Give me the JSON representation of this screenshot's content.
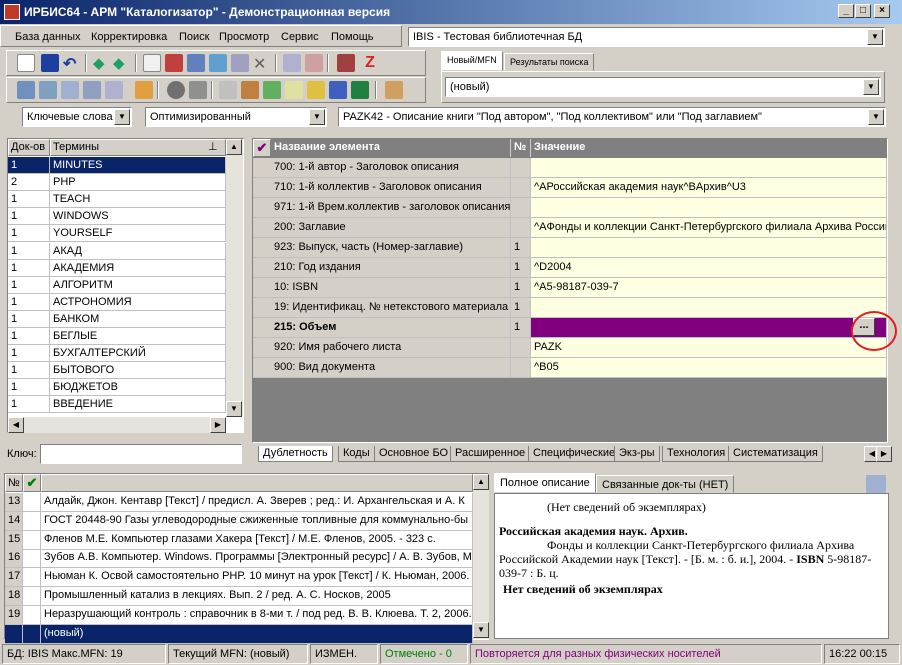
{
  "window": {
    "title": "ИРБИС64 - АРМ \"Каталогизатор\" - Демонстрационная версия",
    "minimize": "_",
    "maximize": "□",
    "close": "×"
  },
  "menu": [
    "База данных",
    "Корректировка",
    "Поиск",
    "Просмотр",
    "Сервис",
    "Помощь"
  ],
  "db_combo": "IBIS - Тестовая библиотечная БД",
  "record_tabs": [
    "Новый/MFN",
    "Результаты поиска"
  ],
  "record_combo": "(новый)",
  "search_mode": "Ключевые слова",
  "optimization": "Оптимизированный",
  "worksheet": "PAZK42 - Описание книги \"Под автором\", \"Под коллективом\" или \"Под заглавием\"",
  "terms": {
    "col_docs": "Док-ов",
    "col_terms": "Термины",
    "pin": "⊥",
    "rows": [
      {
        "count": "1",
        "term": "MINUTES"
      },
      {
        "count": "2",
        "term": "PHP"
      },
      {
        "count": "1",
        "term": "TEACH"
      },
      {
        "count": "1",
        "term": "WINDOWS"
      },
      {
        "count": "1",
        "term": "YOURSELF"
      },
      {
        "count": "1",
        "term": "АКАД"
      },
      {
        "count": "1",
        "term": "АКАДЕМИЯ"
      },
      {
        "count": "1",
        "term": "АЛГОРИТМ"
      },
      {
        "count": "1",
        "term": "АСТРОНОМИЯ"
      },
      {
        "count": "1",
        "term": "БАНКОМ"
      },
      {
        "count": "1",
        "term": "БЕГЛЫЕ"
      },
      {
        "count": "1",
        "term": "БУХГАЛТЕРСКИЙ"
      },
      {
        "count": "1",
        "term": "БЫТОВОГО"
      },
      {
        "count": "1",
        "term": "БЮДЖЕТОВ"
      },
      {
        "count": "1",
        "term": "ВВЕДЕНИЕ"
      }
    ],
    "key_label": "Ключ:"
  },
  "fields": {
    "check": "✔",
    "col_name": "Название элемента",
    "col_num": "№",
    "col_value": "Значение",
    "rows": [
      {
        "name": "700: 1-й  автор - Заголовок описания",
        "num": "",
        "value": ""
      },
      {
        "name": "710: 1-й коллектив - Заголовок описания",
        "num": "",
        "value": "^AРоссийская академия наук^BАрхив^U3"
      },
      {
        "name": "971: 1-й Врем.коллектив - заголовок описания",
        "num": "",
        "value": ""
      },
      {
        "name": "200: Заглавие",
        "num": "",
        "value": "^AФонды и коллекции Санкт-Петербургского филиала Архива Российс"
      },
      {
        "name": "923: Выпуск, часть (Номер-заглавие)",
        "num": "1",
        "value": ""
      },
      {
        "name": "210: Год издания",
        "num": "1",
        "value": "^D2004"
      },
      {
        "name": "10: ISBN",
        "num": "1",
        "value": "^A5-98187-039-7"
      },
      {
        "name": "19: Идентификац. № нетекстового материала",
        "num": "1",
        "value": ""
      },
      {
        "name": "215: Объем",
        "num": "1",
        "value": ""
      },
      {
        "name": "920: Имя рабочего листа",
        "num": "",
        "value": "PAZK"
      },
      {
        "name": "900: Вид документа",
        "num": "",
        "value": "^B05"
      }
    ],
    "ellipsis": "..."
  },
  "bottom_tabs": [
    "Дублетность",
    "Коды",
    "Основное БО",
    "Расширенное",
    "Специфические",
    "Экз-ры",
    "Технология",
    "Систематизация"
  ],
  "records": {
    "col_num": "№",
    "check": "✔",
    "rows": [
      {
        "n": "13",
        "text": "Алдайк, Джон. Кентавр [Текст] / предисл. А. Зверев ; ред.: И. Архангельская и А. К"
      },
      {
        "n": "14",
        "text": "ГОСТ 20448-90 Газы углеводородные сжиженные топливные для коммунально-бы"
      },
      {
        "n": "15",
        "text": "Фленов М.Е. Компьютер глазами Хакера [Текст] / М.Е. Фленов, 2005. - 323 с."
      },
      {
        "n": "16",
        "text": "Зубов А.В. Компьютер. Windows. Программы [Электронный ресурс] / А. В. Зубов, М"
      },
      {
        "n": "17",
        "text": "Ньюман К. Освой самостоятельно PHP. 10 минут на урок [Текст] / К. Ньюман, 2006."
      },
      {
        "n": "18",
        "text": "Промышленный катализ в лекциях. Вып. 2 / ред. А. С. Носков, 2005"
      },
      {
        "n": "19",
        "text": "Неразрушающий контроль : справочник в 8-ми т. / под ред. В. В. Клюева. Т. 2, 2006."
      },
      {
        "n": "",
        "text": "(новый)"
      }
    ]
  },
  "preview": {
    "tabs": [
      "Полное описание",
      "Связанные док-ты (НЕТ)"
    ],
    "line1": "(Нет сведений об экземплярах)",
    "heading": "Российская академия наук. Архив.",
    "body": "Фонды и коллекции Санкт-Петербургского филиала Архива Российской Академии наук [Текст]. - [Б. м. : б. и.], 2004. - ",
    "isbn_label": "ISBN",
    "body2": " 5-98187-039-7 : Б. ц.",
    "footer": "Нет сведений об экземплярах"
  },
  "status": {
    "db": "БД: IBIS Макс.MFN: 19",
    "current": "Текущий MFN: (новый)",
    "changed": "ИЗМЕН.",
    "marked": "Отмечено - 0",
    "hint": "Повторяется для разных физических носителей",
    "time": "16:22  00:15"
  },
  "colors": {
    "selection": "#0a246a",
    "highlight": "#800080",
    "yellow": "#ffffe1",
    "green": "#008000",
    "purple": "#800080",
    "red_circle": "#e02020"
  }
}
